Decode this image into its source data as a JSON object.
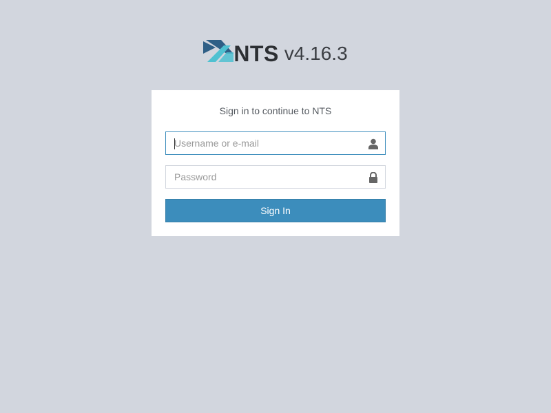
{
  "header": {
    "brand": "NTS",
    "version": "v4.16.3",
    "logo_icon": "nts-logo-icon"
  },
  "login": {
    "message": "Sign in to continue to NTS",
    "username": {
      "placeholder": "Username or e-mail",
      "value": "",
      "icon": "user-icon"
    },
    "password": {
      "placeholder": "Password",
      "value": "",
      "icon": "lock-icon"
    },
    "submit_label": "Sign In"
  },
  "colors": {
    "background": "#d2d6de",
    "primary": "#3c8dbc",
    "logo_dark": "#2f5f86",
    "logo_light": "#4fc1d1"
  }
}
